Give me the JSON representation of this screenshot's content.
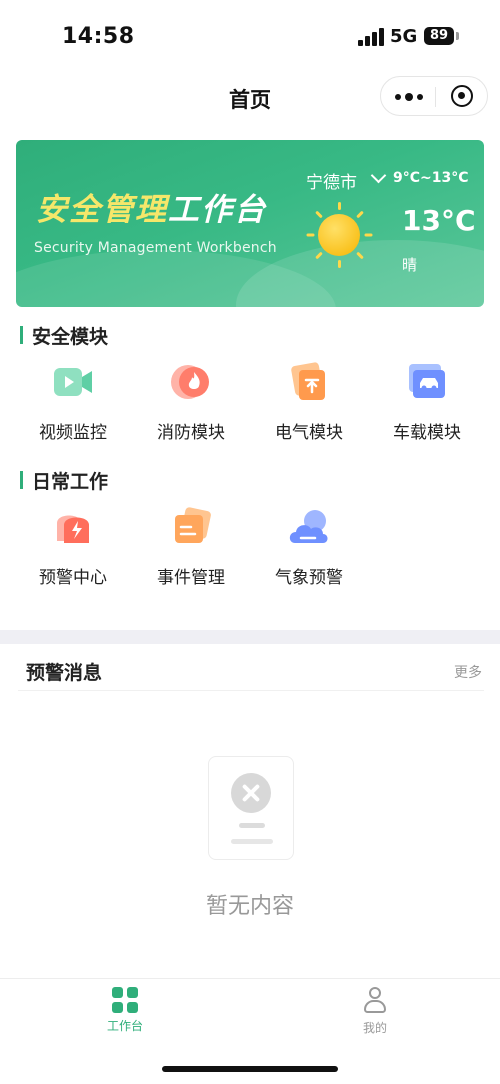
{
  "status_bar": {
    "time": "14:58",
    "network": "5G",
    "battery": "89"
  },
  "nav": {
    "title": "首页"
  },
  "banner": {
    "title_part1": "安全管理",
    "title_part2": "工作台",
    "subtitle": "Security Management Workbench",
    "city": "宁德市",
    "temp_range": "9°C~13°C",
    "temp_now": "13°C",
    "weather": "晴"
  },
  "safety_section": {
    "title": "安全模块",
    "items": [
      {
        "label": "视频监控",
        "icon": "video-icon"
      },
      {
        "label": "消防模块",
        "icon": "fire-icon"
      },
      {
        "label": "电气模块",
        "icon": "electric-icon"
      },
      {
        "label": "车载模块",
        "icon": "car-icon"
      }
    ]
  },
  "daily_section": {
    "title": "日常工作",
    "items": [
      {
        "label": "预警中心",
        "icon": "alarm-icon"
      },
      {
        "label": "事件管理",
        "icon": "document-icon"
      },
      {
        "label": "气象预警",
        "icon": "cloud-icon"
      }
    ]
  },
  "alerts": {
    "title": "预警消息",
    "more": "更多",
    "empty_text": "暂无内容"
  },
  "tabbar": {
    "items": [
      {
        "label": "工作台",
        "icon": "grid-icon",
        "active": true
      },
      {
        "label": "我的",
        "icon": "person-icon",
        "active": false
      }
    ]
  },
  "colors": {
    "accent": "#2fae7a",
    "title_yellow": "#f5e76a"
  }
}
